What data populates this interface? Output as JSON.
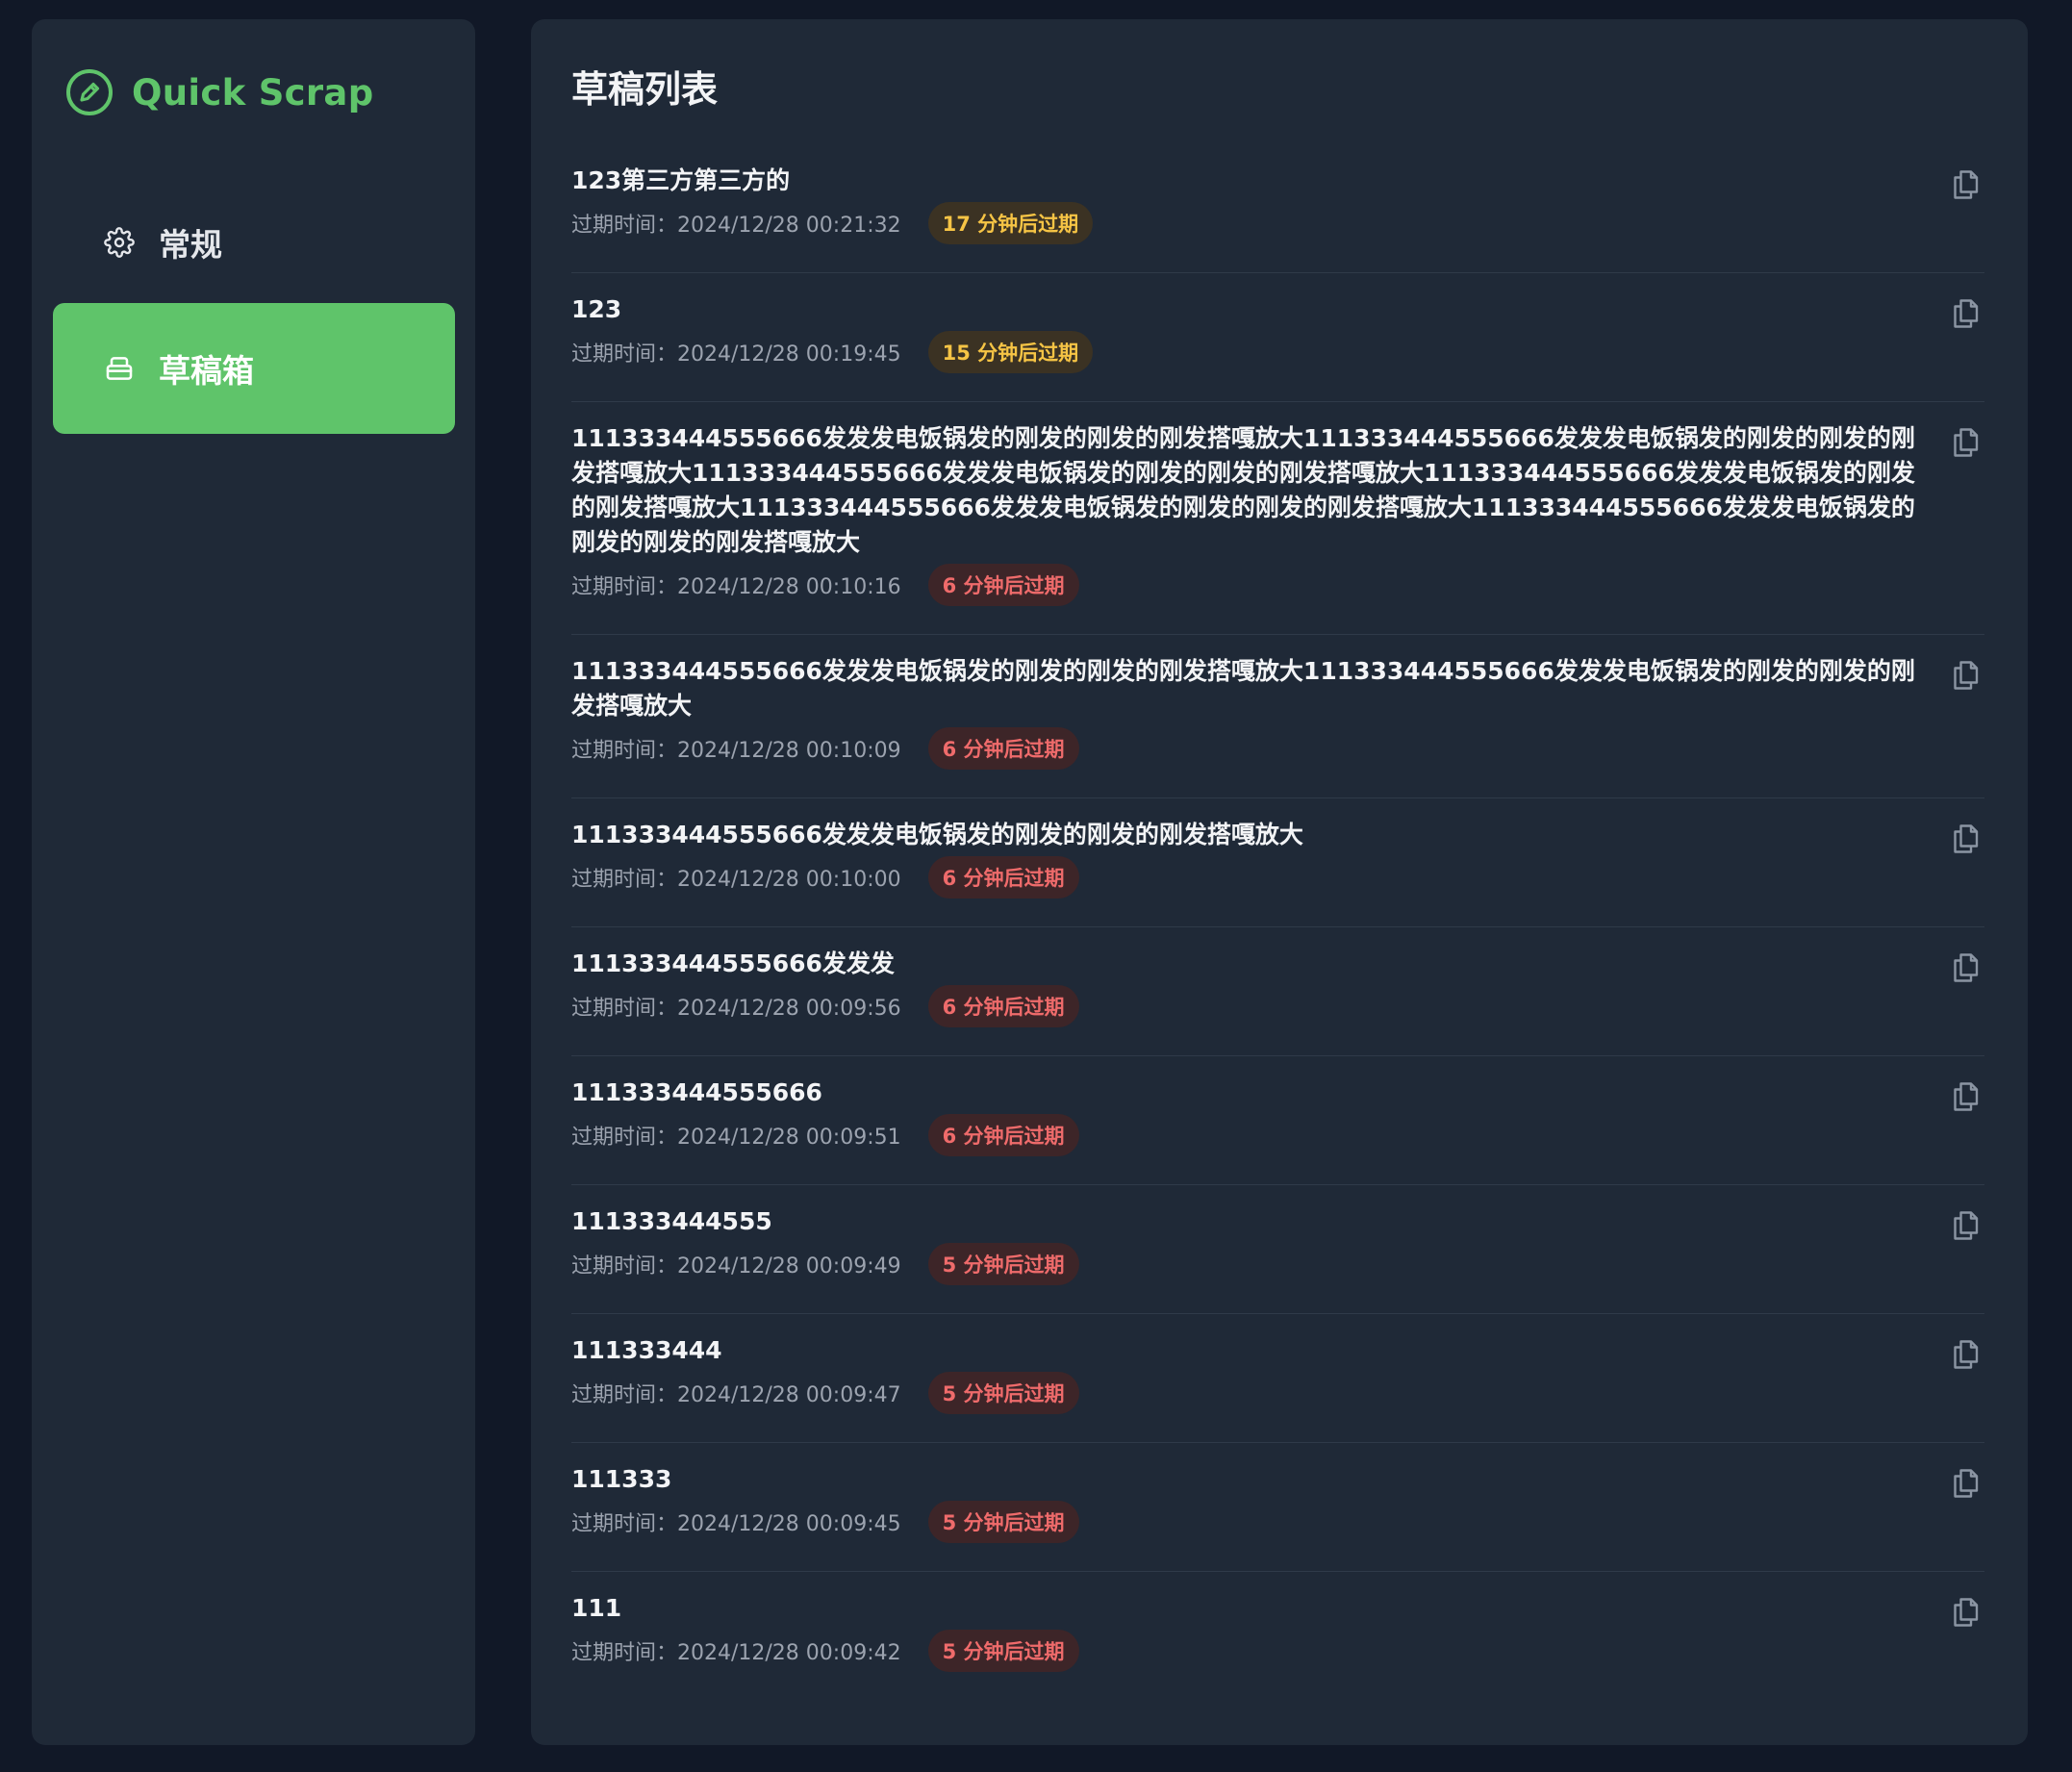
{
  "sidebar": {
    "brand": {
      "title": "Quick Scrap",
      "icon": "pencil-circle-icon",
      "color": "#5fc46a"
    },
    "items": [
      {
        "label": "常规",
        "icon": "gear-icon",
        "active": false
      },
      {
        "label": "草稿箱",
        "icon": "drafts-box-icon",
        "active": true
      }
    ]
  },
  "main": {
    "title": "草稿列表",
    "drafts": [
      {
        "text": "123第三方第三方的",
        "expire": "过期时间：2024/12/28 00:21:32",
        "badge": "17 分钟后过期",
        "level": "warn"
      },
      {
        "text": "123",
        "expire": "过期时间：2024/12/28 00:19:45",
        "badge": "15 分钟后过期",
        "level": "warn"
      },
      {
        "text": "111333444555666发发发电饭锅发的刚发的刚发的刚发搭嘎放大111333444555666发发发电饭锅发的刚发的刚发的刚发搭嘎放大111333444555666发发发电饭锅发的刚发的刚发的刚发搭嘎放大111333444555666发发发电饭锅发的刚发的刚发搭嘎放大111333444555666发发发电饭锅发的刚发的刚发的刚发搭嘎放大111333444555666发发发电饭锅发的刚发的刚发的刚发搭嘎放大",
        "expire": "过期时间：2024/12/28 00:10:16",
        "badge": "6 分钟后过期",
        "level": "danger"
      },
      {
        "text": "111333444555666发发发电饭锅发的刚发的刚发的刚发搭嘎放大111333444555666发发发电饭锅发的刚发的刚发的刚发搭嘎放大",
        "expire": "过期时间：2024/12/28 00:10:09",
        "badge": "6 分钟后过期",
        "level": "danger"
      },
      {
        "text": "111333444555666发发发电饭锅发的刚发的刚发的刚发搭嘎放大",
        "expire": "过期时间：2024/12/28 00:10:00",
        "badge": "6 分钟后过期",
        "level": "danger"
      },
      {
        "text": "111333444555666发发发",
        "expire": "过期时间：2024/12/28 00:09:56",
        "badge": "6 分钟后过期",
        "level": "danger"
      },
      {
        "text": "111333444555666",
        "expire": "过期时间：2024/12/28 00:09:51",
        "badge": "6 分钟后过期",
        "level": "danger"
      },
      {
        "text": "111333444555",
        "expire": "过期时间：2024/12/28 00:09:49",
        "badge": "5 分钟后过期",
        "level": "danger"
      },
      {
        "text": "111333444",
        "expire": "过期时间：2024/12/28 00:09:47",
        "badge": "5 分钟后过期",
        "level": "danger"
      },
      {
        "text": "111333",
        "expire": "过期时间：2024/12/28 00:09:45",
        "badge": "5 分钟后过期",
        "level": "danger"
      },
      {
        "text": "111",
        "expire": "过期时间：2024/12/28 00:09:42",
        "badge": "5 分钟后过期",
        "level": "danger"
      }
    ],
    "copy_icon": "copy-icon"
  },
  "colors": {
    "accent": "#5fc46a",
    "warn_badge_text": "#f6c445",
    "danger_badge_text": "#ef6b6b",
    "panel_bg": "#1f2937",
    "page_bg": "#111827"
  }
}
